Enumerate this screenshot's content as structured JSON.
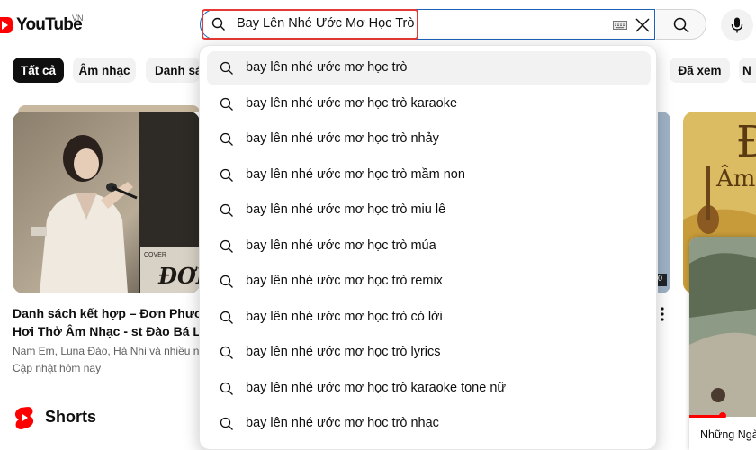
{
  "header": {
    "logo_text": "YouTube",
    "country_code": "VN",
    "search_value": "Bay Lên Nhé Ước Mơ Học Trò"
  },
  "chips": [
    "Tất cả",
    "Âm nhạc",
    "Danh sá",
    "Đã xem",
    "N"
  ],
  "video_card": {
    "title_line1": "Danh sách kết hợp – Đơn Phươn",
    "title_line2": "Hơi Thở Âm Nhạc - st Đào Bá Lộ",
    "channels": "Nam Em, Luna Đào, Hà Nhi và nhiều n",
    "updated": "Cập nhật hôm nay",
    "thumb_text_cover": "COVER",
    "thumb_text_title": "ĐƠN"
  },
  "shorts": {
    "label": "Shorts"
  },
  "right_card": {
    "title_fragment": "Đ",
    "subtitle_fragment": "Âm",
    "popup_label": "Những Ngà",
    "badge_text": "0"
  },
  "suggestions": [
    "bay lên nhé ước mơ học trò",
    "bay lên nhé ước mơ học trò karaoke",
    "bay lên nhé ước mơ học trò nhảy",
    "bay lên nhé ước mơ học trò mầm non",
    "bay lên nhé ước mơ học trò miu lê",
    "bay lên nhé ước mơ học trò múa",
    "bay lên nhé ước mơ học trò remix",
    "bay lên nhé ước mơ học trò có lời",
    "bay lên nhé ước mơ học trò lyrics",
    "bay lên nhé ước mơ học trò karaoke tone nữ",
    "bay lên nhé ước mơ học trò nhạc"
  ],
  "colors": {
    "brand_red": "#ff0000",
    "highlight_red": "#e53935",
    "focus_blue": "#1c62b9"
  }
}
